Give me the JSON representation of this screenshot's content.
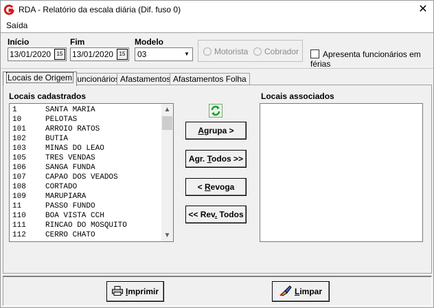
{
  "window": {
    "title": "RDA - Relatório da escala diária (Dif. fuso 0)",
    "close_glyph": "✕"
  },
  "menu": {
    "saida": "Saída"
  },
  "header": {
    "inicio_label": "Início",
    "inicio_value": "13/01/2020",
    "fim_label": "Fim",
    "fim_value": "13/01/2020",
    "calendar_glyph": "15",
    "modelo_label": "Modelo",
    "modelo_value": "03",
    "motorista_label": "Motorista",
    "cobrador_label": "Cobrador",
    "ferias_label": "Apresenta funcionários em férias"
  },
  "tabs": [
    {
      "label": "Locais de Origem"
    },
    {
      "label": "Funcionários"
    },
    {
      "label": "Afastamentos"
    },
    {
      "label": "Afastamentos Folha"
    }
  ],
  "lists": {
    "cadastrados_header": "Locais cadastrados",
    "associados_header": "Locais associados",
    "cadastrados": [
      {
        "code": "1",
        "name": "SANTA MARIA"
      },
      {
        "code": "10",
        "name": "PELOTAS"
      },
      {
        "code": "101",
        "name": "ARROIO RATOS"
      },
      {
        "code": "102",
        "name": "BUTIA"
      },
      {
        "code": "103",
        "name": "MINAS DO LEAO"
      },
      {
        "code": "105",
        "name": "TRES VENDAS"
      },
      {
        "code": "106",
        "name": "SANGA FUNDA"
      },
      {
        "code": "107",
        "name": "CAPAO DOS VEADOS"
      },
      {
        "code": "108",
        "name": "CORTADO"
      },
      {
        "code": "109",
        "name": "MARUPIARA"
      },
      {
        "code": "11",
        "name": "PASSO FUNDO"
      },
      {
        "code": "110",
        "name": "BOA VISTA CCH"
      },
      {
        "code": "111",
        "name": "RINCAO DO MOSQUITO"
      },
      {
        "code": "112",
        "name": "CERRO CHATO"
      }
    ]
  },
  "actions": {
    "agrupa_pre": "",
    "agrupa_key": "A",
    "agrupa_post": "grupa >",
    "agr_todos_pre": "Agr. ",
    "agr_todos_key": "T",
    "agr_todos_post": "odos >>",
    "revoga_pre": "< ",
    "revoga_key": "R",
    "revoga_post": "evoga",
    "rev_todos_pre": "<< Rev",
    "rev_todos_key": ".",
    "rev_todos_post": " Todos"
  },
  "footer": {
    "imprimir_key": "I",
    "imprimir_post": "mprimir",
    "limpar_key": "L",
    "limpar_post": "impar"
  },
  "colors": {
    "refresh": "#1a9a2a",
    "logo": "#d01b1b"
  }
}
